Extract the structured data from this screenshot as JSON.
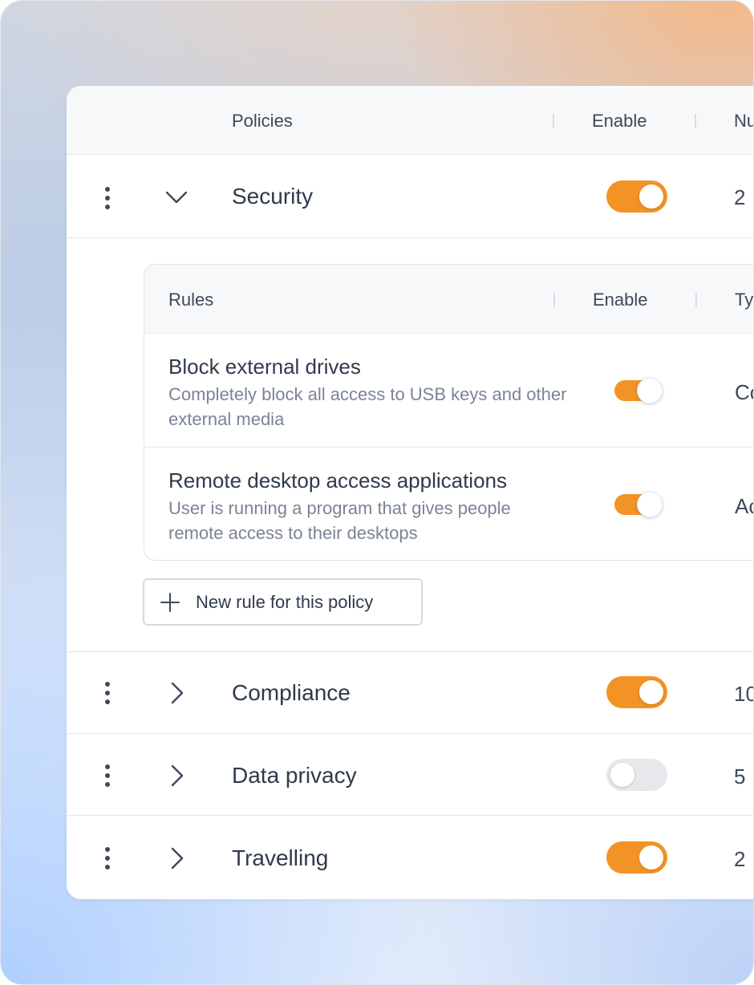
{
  "table": {
    "columns": {
      "policies": "Policies",
      "enable": "Enable",
      "number": "Nu"
    }
  },
  "policies": [
    {
      "name": "Security",
      "enabled": true,
      "expanded": true,
      "count": "2"
    },
    {
      "name": "Compliance",
      "enabled": true,
      "expanded": false,
      "count": "10"
    },
    {
      "name": "Data privacy",
      "enabled": false,
      "expanded": false,
      "count": "5"
    },
    {
      "name": "Travelling",
      "enabled": true,
      "expanded": false,
      "count": "2"
    }
  ],
  "rules": {
    "columns": {
      "rules": "Rules",
      "enable": "Enable",
      "type": "Ty"
    },
    "items": [
      {
        "title": "Block external drives",
        "description": "Completely block all access to USB keys and other external media",
        "enabled": true,
        "type": "Co"
      },
      {
        "title": "Remote desktop access applications",
        "description": "User is running a program that gives people remote access to their desktops",
        "enabled": true,
        "type": "Ac"
      }
    ],
    "new_rule_label": "New rule for this policy"
  },
  "colors": {
    "accent": "#f39325",
    "toggle_off": "#e6e8ec",
    "text": "#2f3a4b",
    "muted": "#7a8496"
  }
}
